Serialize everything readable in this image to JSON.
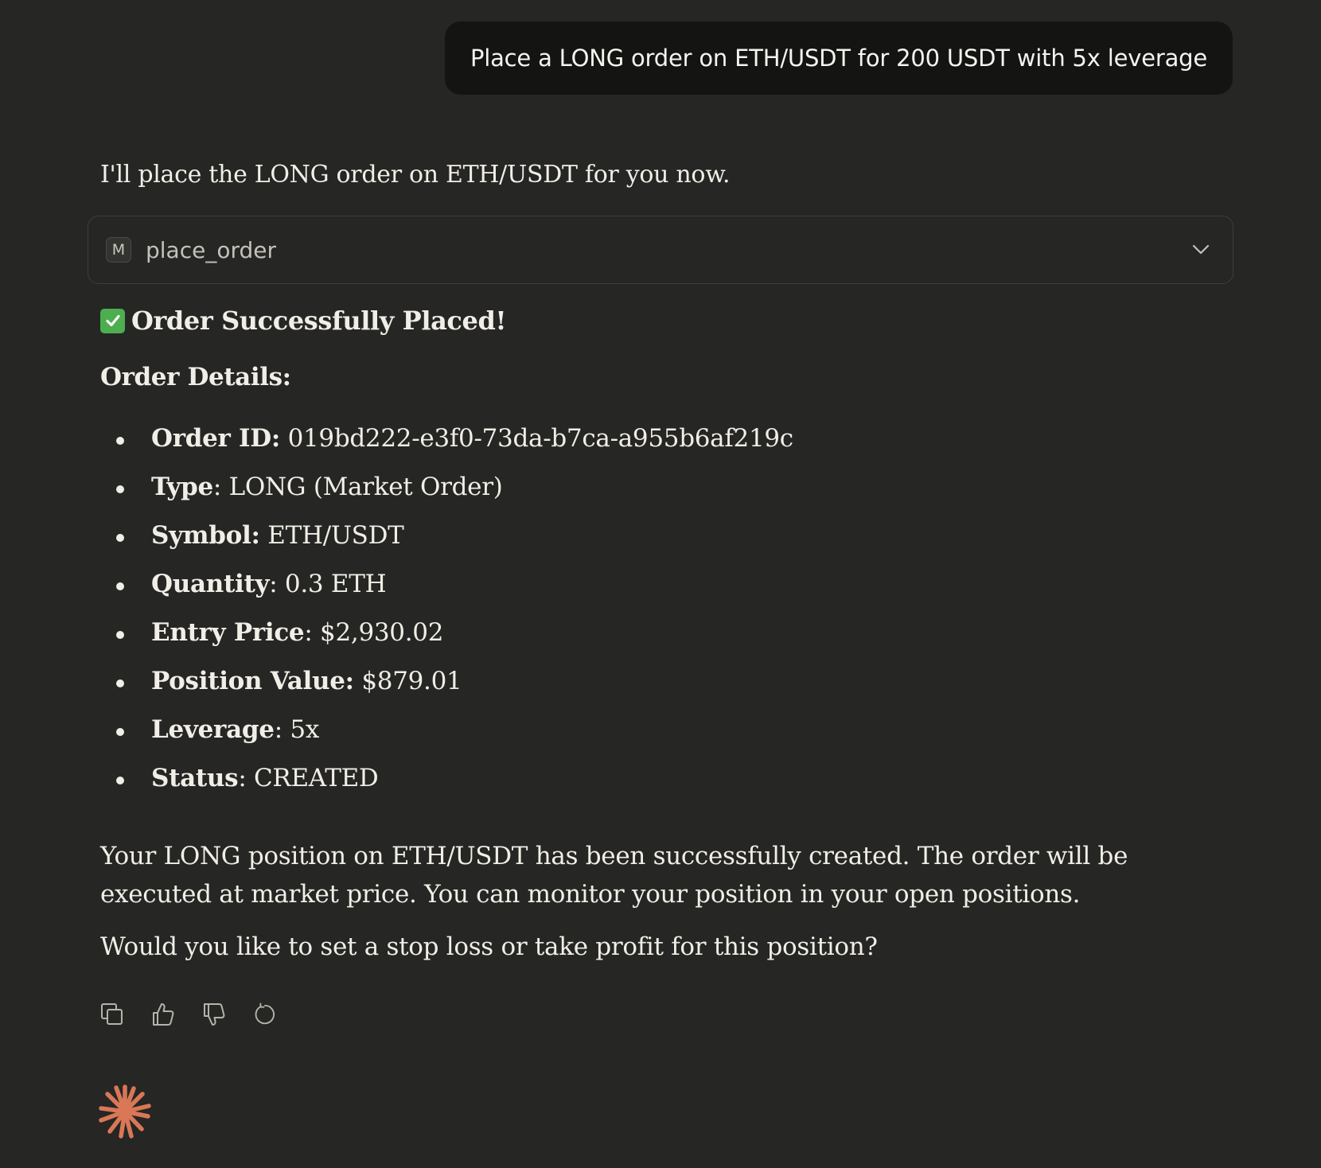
{
  "user_message": {
    "text": "Place a LONG order on ETH/USDT for 200 USDT with 5x leverage"
  },
  "assistant": {
    "intro": "I'll place the LONG order on ETH/USDT for you now.",
    "tool_call": {
      "badge": "M",
      "name": "place_order",
      "expand_icon": "chevron-down-icon"
    },
    "success_icon": "check-mark-icon",
    "success_title": "Order Successfully Placed!",
    "details_heading": "Order Details:",
    "details": [
      {
        "label": "Order ID",
        "value": "019bd222-e3f0-73da-b7ca-a955b6af219c"
      },
      {
        "label": "Type",
        "value": "LONG (Market Order)"
      },
      {
        "label": "Symbol",
        "value": "ETH/USDT"
      },
      {
        "label": "Quantity",
        "value": "0.3 ETH"
      },
      {
        "label": "Entry Price",
        "value": "$2,930.02"
      },
      {
        "label": "Position Value",
        "value": "$879.01"
      },
      {
        "label": "Leverage",
        "value": "5x"
      },
      {
        "label": "Status",
        "value": "CREATED"
      }
    ],
    "summary": "Your LONG position on ETH/USDT has been successfully created. The order will be executed at market price. You can monitor your position in your open positions.",
    "question": "Would you like to set a stop loss or take profit for this position?",
    "actions": [
      {
        "name": "copy",
        "icon": "copy-icon"
      },
      {
        "name": "thumbs-up",
        "icon": "thumbs-up-icon"
      },
      {
        "name": "thumbs-down",
        "icon": "thumbs-down-icon"
      },
      {
        "name": "retry",
        "icon": "retry-icon"
      }
    ]
  },
  "colors": {
    "background": "#262624",
    "user_bubble": "#141413",
    "text": "#f0eee6",
    "success_green": "#4cae4f",
    "brand_spark": "#d97757"
  }
}
